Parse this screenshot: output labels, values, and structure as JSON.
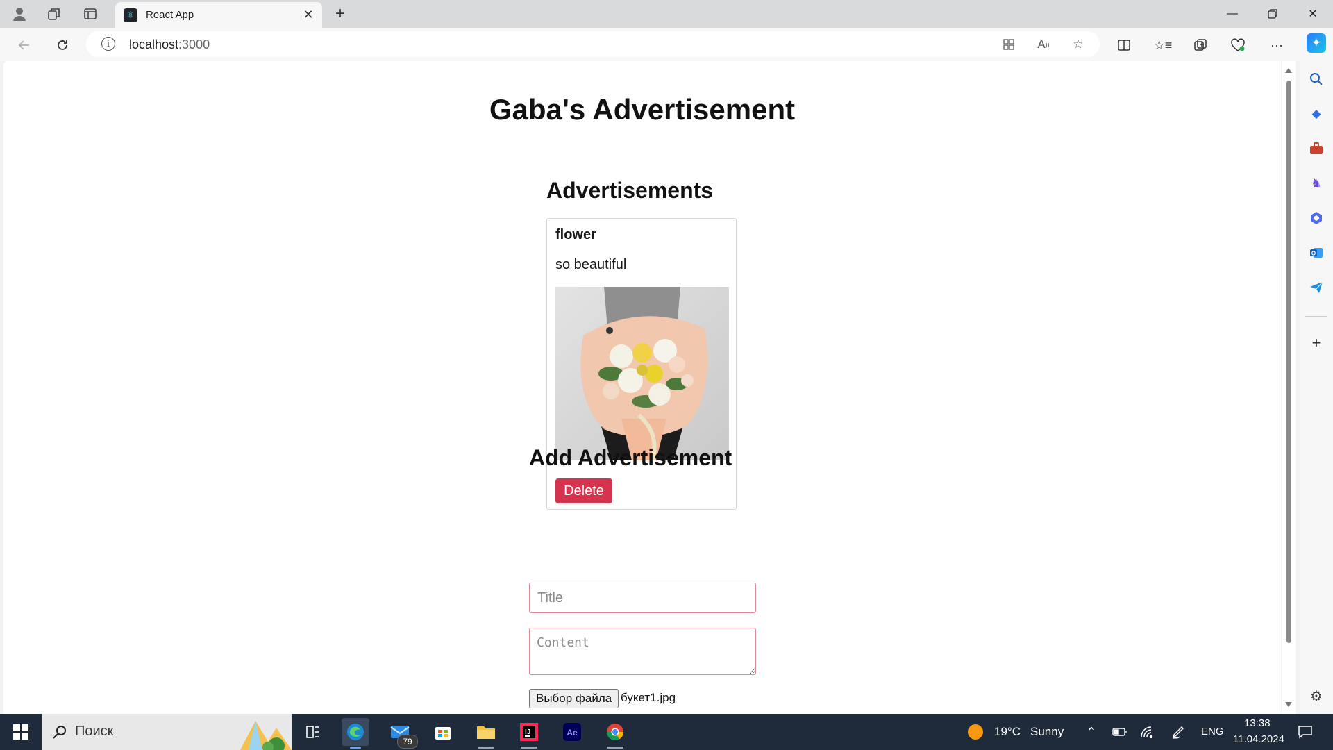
{
  "browser": {
    "tab_title": "React App",
    "url_host": "localhost",
    "url_port": ":3000"
  },
  "page": {
    "app_title": "Gaba's Advertisement",
    "ads_heading": "Advertisements",
    "ads": [
      {
        "title": "flower",
        "content": "so beautiful",
        "delete_label": "Delete",
        "image_icon": "bouquet-photo"
      }
    ],
    "add_heading": "Add Advertisement",
    "form": {
      "title_placeholder": "Title",
      "content_placeholder": "Content",
      "file_button_label": "Выбор файла",
      "file_name": "букет1.jpg"
    },
    "accent_color": "#d6334f"
  },
  "taskbar": {
    "search_placeholder": "Поиск",
    "mail_badge": "79",
    "weather_temp": "19°C",
    "weather_text": "Sunny",
    "language": "ENG",
    "time": "13:38",
    "date": "11.04.2024"
  }
}
